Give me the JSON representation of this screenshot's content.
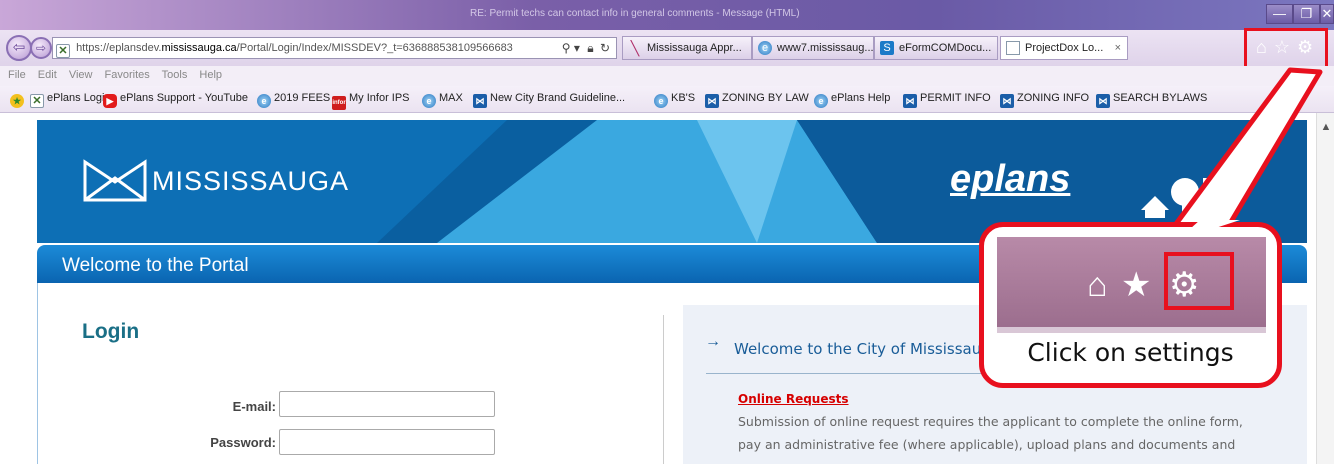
{
  "browser": {
    "window_title": "RE: Permit techs can contact info in general comments - Message (HTML)",
    "address": {
      "prefix": "https://eplansdev.",
      "domain": "mississauga.ca",
      "path": "/Portal/Login/Index/MISSDEV?_t=636888538109566683"
    },
    "tabs": [
      {
        "label": "Mississauga Appr..."
      },
      {
        "label": "www7.mississaug..."
      },
      {
        "label": "eFormCOMDocu..."
      },
      {
        "label": "ProjectDox Lo..."
      }
    ],
    "tab_close": "×",
    "menu": [
      "File",
      "Edit",
      "View",
      "Favorites",
      "Tools",
      "Help"
    ],
    "favorites": [
      {
        "label": "ePlans Login"
      },
      {
        "label": "ePlans Support - YouTube"
      },
      {
        "label": "2019 FEES"
      },
      {
        "label": "My Infor IPS"
      },
      {
        "label": "MAX"
      },
      {
        "label": "New City Brand Guideline..."
      },
      {
        "label": "KB'S"
      },
      {
        "label": "ZONING BY LAW"
      },
      {
        "label": "ePlans Help"
      },
      {
        "label": "PERMIT INFO"
      },
      {
        "label": "ZONING INFO"
      },
      {
        "label": "SEARCH BYLAWS"
      }
    ]
  },
  "page": {
    "logo_text": "MISSISSAUGA",
    "eplans_logo": "eplans",
    "welcome_bar": "Welcome to the Portal",
    "login": {
      "title": "Login",
      "email_label": "E-mail:",
      "password_label": "Password:"
    },
    "right_panel": {
      "arrow": "→",
      "welcome": "Welcome to the City of Mississauga",
      "online_title": "Online Requests",
      "body_line1": "Submission of online request requires the applicant to complete the online form,",
      "body_line2": "pay an administrative fee (where applicable), upload plans and documents and"
    }
  },
  "callout": {
    "caption": "Click on settings"
  },
  "colors": {
    "highlight": "#e8101e",
    "banner": "#0a5fa0",
    "welcome_bar": "#1278c6",
    "login_title": "#1a6f86"
  }
}
